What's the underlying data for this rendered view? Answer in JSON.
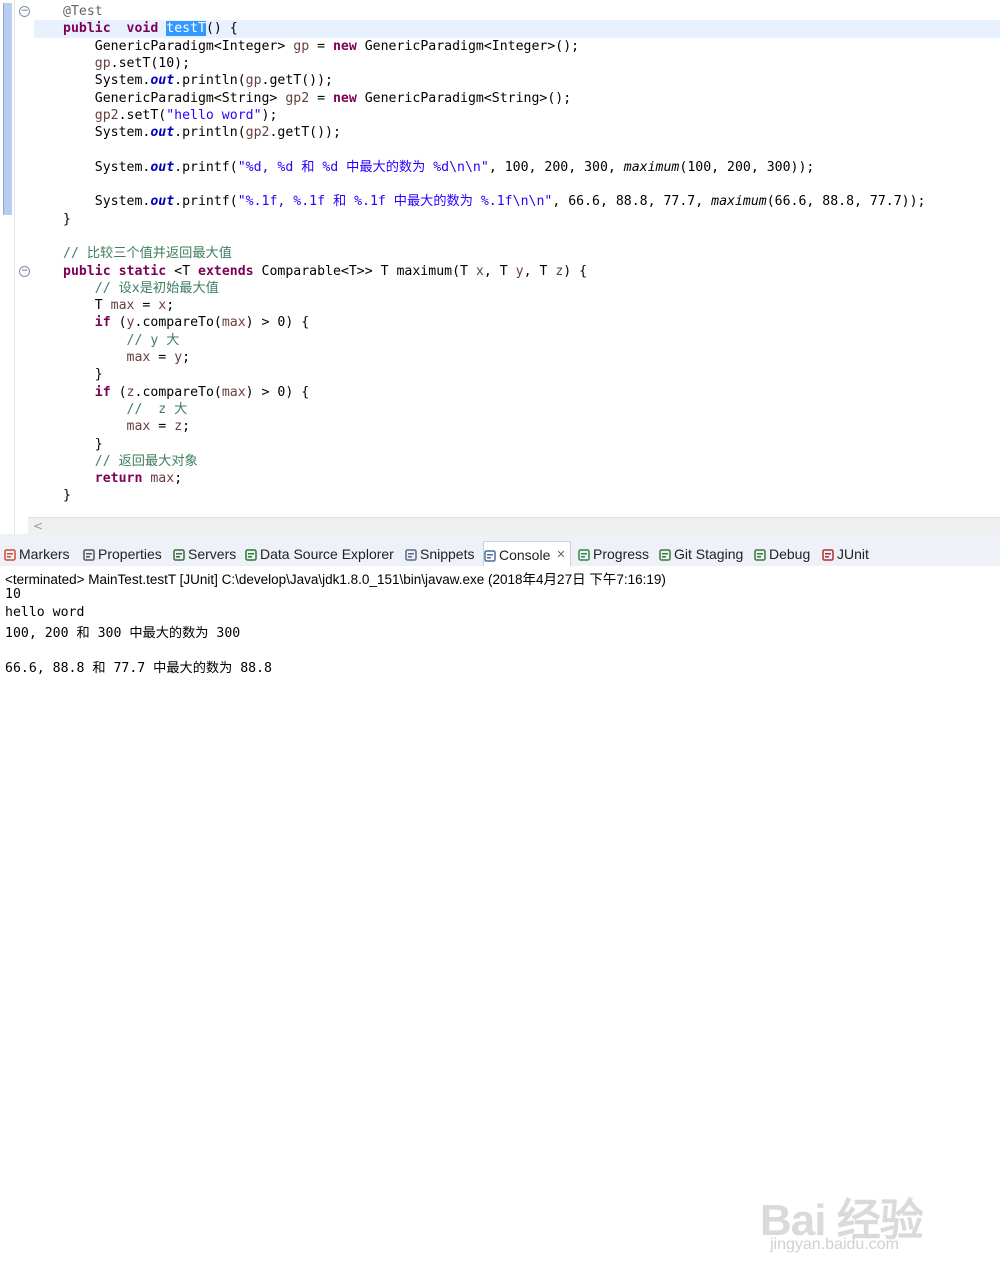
{
  "editor": {
    "lines": [
      {
        "segs": [
          [
            "ann",
            "@Test"
          ]
        ]
      },
      {
        "segs": [
          [
            "kw",
            "public"
          ],
          [
            "",
            "  "
          ],
          [
            "kw",
            "void"
          ],
          [
            "",
            " "
          ],
          [
            "sel",
            "testT"
          ],
          [
            "",
            "() {"
          ]
        ]
      },
      {
        "segs": [
          [
            "",
            "    GenericParadigm<Integer> "
          ],
          [
            "var",
            "gp"
          ],
          [
            "",
            " = "
          ],
          [
            "kw",
            "new"
          ],
          [
            "",
            " GenericParadigm<Integer>();"
          ]
        ]
      },
      {
        "segs": [
          [
            "",
            "    "
          ],
          [
            "var",
            "gp"
          ],
          [
            "",
            ".setT(10);"
          ]
        ]
      },
      {
        "segs": [
          [
            "",
            "    System."
          ],
          [
            "fld",
            "out"
          ],
          [
            "",
            ".println("
          ],
          [
            "var",
            "gp"
          ],
          [
            "",
            ".getT());"
          ]
        ]
      },
      {
        "segs": [
          [
            "",
            "    GenericParadigm<String> "
          ],
          [
            "var",
            "gp2"
          ],
          [
            "",
            " = "
          ],
          [
            "kw",
            "new"
          ],
          [
            "",
            " GenericParadigm<String>();"
          ]
        ]
      },
      {
        "segs": [
          [
            "",
            "    "
          ],
          [
            "var",
            "gp2"
          ],
          [
            "",
            ".setT("
          ],
          [
            "str",
            "\"hello word\""
          ],
          [
            "",
            ");"
          ]
        ]
      },
      {
        "segs": [
          [
            "",
            "    System."
          ],
          [
            "fld",
            "out"
          ],
          [
            "",
            ".println("
          ],
          [
            "var",
            "gp2"
          ],
          [
            "",
            ".getT());"
          ]
        ]
      },
      {
        "segs": []
      },
      {
        "segs": [
          [
            "",
            "    System."
          ],
          [
            "fld",
            "out"
          ],
          [
            "",
            ".printf("
          ],
          [
            "str",
            "\"%d, %d 和 %d 中最大的数为 %d\\n\\n\""
          ],
          [
            "",
            ", 100, 200, 300, "
          ],
          [
            "itl",
            "maximum"
          ],
          [
            "",
            "(100, 200, 300));"
          ]
        ]
      },
      {
        "segs": []
      },
      {
        "segs": [
          [
            "",
            "    System."
          ],
          [
            "fld",
            "out"
          ],
          [
            "",
            ".printf("
          ],
          [
            "str",
            "\"%.1f, %.1f 和 %.1f 中最大的数为 %.1f\\n\\n\""
          ],
          [
            "",
            ", 66.6, 88.8, 77.7, "
          ],
          [
            "itl",
            "maximum"
          ],
          [
            "",
            "(66.6, 88.8, 77.7));"
          ]
        ]
      },
      {
        "segs": [
          [
            "",
            "}"
          ]
        ]
      },
      {
        "segs": []
      },
      {
        "segs": [
          [
            "cmt",
            "// 比较三个值并返回最大值"
          ]
        ]
      },
      {
        "segs": [
          [
            "kw",
            "public"
          ],
          [
            "",
            " "
          ],
          [
            "kw",
            "static"
          ],
          [
            "",
            " <T "
          ],
          [
            "kw",
            "extends"
          ],
          [
            "",
            " Comparable<T>> T maximum(T "
          ],
          [
            "var",
            "x"
          ],
          [
            "",
            ", T "
          ],
          [
            "var",
            "y"
          ],
          [
            "",
            ", T "
          ],
          [
            "var",
            "z"
          ],
          [
            "",
            ") {"
          ]
        ]
      },
      {
        "segs": [
          [
            "",
            "    "
          ],
          [
            "cmt",
            "// 设x是初始最大值"
          ]
        ]
      },
      {
        "segs": [
          [
            "",
            "    T "
          ],
          [
            "var",
            "max"
          ],
          [
            "",
            " = "
          ],
          [
            "var",
            "x"
          ],
          [
            "",
            ";"
          ]
        ]
      },
      {
        "segs": [
          [
            "",
            "    "
          ],
          [
            "kw",
            "if"
          ],
          [
            "",
            " ("
          ],
          [
            "var",
            "y"
          ],
          [
            "",
            ".compareTo("
          ],
          [
            "var",
            "max"
          ],
          [
            "",
            ") > 0) {"
          ]
        ]
      },
      {
        "segs": [
          [
            "",
            "        "
          ],
          [
            "cmt",
            "// y 大"
          ]
        ]
      },
      {
        "segs": [
          [
            "",
            "        "
          ],
          [
            "var",
            "max"
          ],
          [
            "",
            " = "
          ],
          [
            "var",
            "y"
          ],
          [
            "",
            ";"
          ]
        ]
      },
      {
        "segs": [
          [
            "",
            "    }"
          ]
        ]
      },
      {
        "segs": [
          [
            "",
            "    "
          ],
          [
            "kw",
            "if"
          ],
          [
            "",
            " ("
          ],
          [
            "var",
            "z"
          ],
          [
            "",
            ".compareTo("
          ],
          [
            "var",
            "max"
          ],
          [
            "",
            ") > 0) {"
          ]
        ]
      },
      {
        "segs": [
          [
            "",
            "        "
          ],
          [
            "cmt",
            "//  z 大"
          ]
        ]
      },
      {
        "segs": [
          [
            "",
            "        "
          ],
          [
            "var",
            "max"
          ],
          [
            "",
            " = "
          ],
          [
            "var",
            "z"
          ],
          [
            "",
            ";"
          ]
        ]
      },
      {
        "segs": [
          [
            "",
            "    }"
          ]
        ]
      },
      {
        "segs": [
          [
            "",
            "    "
          ],
          [
            "cmt",
            "// 返回最大对象"
          ]
        ]
      },
      {
        "segs": [
          [
            "",
            "    "
          ],
          [
            "kw",
            "return"
          ],
          [
            "",
            " "
          ],
          [
            "var",
            "max"
          ],
          [
            "",
            ";"
          ]
        ]
      },
      {
        "segs": [
          [
            "",
            "}"
          ]
        ]
      }
    ],
    "current_line": 1,
    "fold_markers": [
      0,
      15
    ],
    "changed_lines": [
      0,
      12
    ]
  },
  "tabs": [
    {
      "label": "Markers",
      "icon": "markers-icon",
      "color": "#d04a3a"
    },
    {
      "label": "Properties",
      "icon": "properties-icon",
      "color": "#555555"
    },
    {
      "label": "Servers",
      "icon": "servers-icon",
      "color": "#3a6a3a"
    },
    {
      "label": "Data Source Explorer",
      "icon": "data-source-icon",
      "color": "#2f7a2f"
    },
    {
      "label": "Snippets",
      "icon": "snippets-icon",
      "color": "#5a6a8a"
    },
    {
      "label": "Console",
      "icon": "console-icon",
      "color": "#4a6aa0",
      "active": true
    },
    {
      "label": "Progress",
      "icon": "progress-icon",
      "color": "#2f8a4a"
    },
    {
      "label": "Git Staging",
      "icon": "git-staging-icon",
      "color": "#3a7a3a"
    },
    {
      "label": "Debug",
      "icon": "debug-icon",
      "color": "#3a7a3a"
    },
    {
      "label": "JUnit",
      "icon": "junit-icon",
      "color": "#b03030"
    }
  ],
  "console": {
    "header": "<terminated> MainTest.testT [JUnit] C:\\develop\\Java\\jdk1.8.0_151\\bin\\javaw.exe (2018年4月27日 下午7:16:19)",
    "lines": [
      "10",
      "hello word",
      "100, 200 和 300 中最大的数为 300",
      "",
      "66.6, 88.8 和 77.7 中最大的数为 88.8"
    ]
  },
  "watermark": {
    "text": "Bai 经验",
    "sub": "jingyan.baidu.com"
  }
}
